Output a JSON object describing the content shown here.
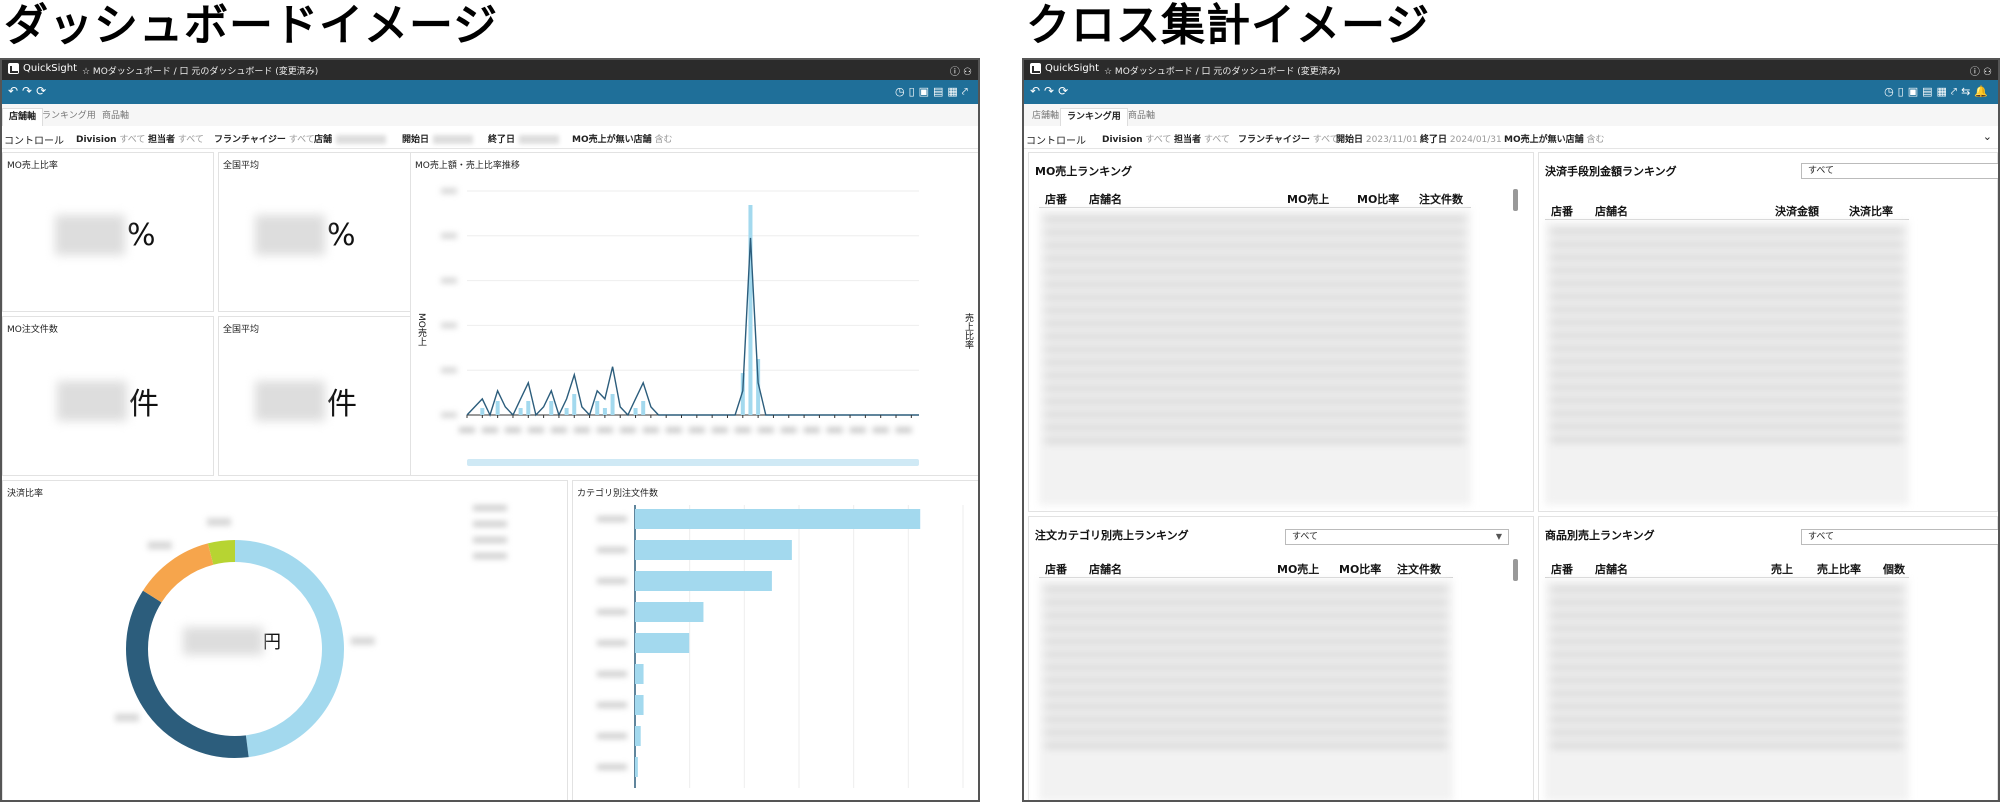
{
  "headings": {
    "dashboard": "ダッシュボードイメージ",
    "crosstab": "クロス集計イメージ"
  },
  "app": {
    "brand": "QuickSight",
    "breadcrumb_left": "☆ MOダッシュボード / 口 元のダッシュボード (変更済み)",
    "breadcrumb_right": "☆ MOダッシュボード / 口 元のダッシュボード (変更済み)"
  },
  "left": {
    "tabs": [
      "店舗軸",
      "ランキング用",
      "商品軸"
    ],
    "active_tab": 0,
    "controls": {
      "label": "コントロール",
      "division": "Division",
      "division_val": "すべて",
      "tanto": "担当者",
      "tanto_val": "すべて",
      "franchise": "フランチャイジー",
      "franchise_val": "すべて",
      "store": "店舗",
      "start": "開始日",
      "end": "終了日",
      "low": "MO売上が無い店舗",
      "low_val": "含む"
    },
    "kpis": [
      {
        "title": "MO売上比率",
        "unit": "%"
      },
      {
        "title": "全国平均",
        "unit": "%"
      },
      {
        "title": "MO注文件数",
        "unit": "件"
      },
      {
        "title": "全国平均",
        "unit": "件"
      }
    ],
    "trend_title": "MO売上額・売上比率推移",
    "trend_ylabel": "MO売上",
    "trend_y2label": "売上比率",
    "donut_title": "決済比率",
    "donut_unit": "円",
    "bars_title": "カテゴリ別注文件数"
  },
  "right": {
    "tabs": [
      "店舗軸",
      "ランキング用",
      "商品軸"
    ],
    "active_tab": 1,
    "controls": {
      "label": "コントロール",
      "division": "Division",
      "division_val": "すべて",
      "tanto": "担当者",
      "tanto_val": "すべて",
      "franchise": "フランチャイジー",
      "franchise_val": "すべて",
      "start": "開始日",
      "start_val": "2023/11/01",
      "end": "終了日",
      "end_val": "2024/01/31",
      "low": "MO売上が無い店舗",
      "low_val": "含む"
    },
    "t1": {
      "title": "MO売上ランキング",
      "cols": [
        "店番",
        "店舗名",
        "MO売上",
        "MO比率",
        "注文件数"
      ]
    },
    "t2": {
      "title": "決済手段別金額ランキング",
      "select": "すべて",
      "cols": [
        "店番",
        "店舗名",
        "決済金額",
        "決済比率"
      ]
    },
    "t3": {
      "title": "注文カテゴリ別売上ランキング",
      "select": "すべて",
      "cols": [
        "店番",
        "店舗名",
        "MO売上",
        "MO比率",
        "注文件数"
      ]
    },
    "t4": {
      "title": "商品別売上ランキング",
      "select": "すべて",
      "cols": [
        "店番",
        "店舗名",
        "売上",
        "売上比率",
        "個数"
      ]
    }
  },
  "chart_data": [
    {
      "type": "line",
      "title": "MO売上額・売上比率推移",
      "ylabel": "MO売上",
      "series": [
        {
          "values": [
            0,
            1,
            2,
            0,
            3,
            1,
            0,
            2,
            4,
            0,
            1,
            3,
            0,
            2,
            5,
            1,
            0,
            3,
            2,
            6,
            1,
            0,
            2,
            4,
            1,
            0,
            0,
            0,
            0,
            0,
            0,
            0,
            0,
            0,
            0,
            0,
            3,
            22,
            4,
            0,
            0,
            0,
            0,
            0,
            0,
            0,
            0,
            0,
            0,
            0,
            0,
            0,
            0,
            0,
            0,
            0,
            0,
            0,
            0,
            0
          ]
        },
        {
          "values": [
            0,
            0,
            1,
            0,
            2,
            0,
            0,
            1,
            2,
            0,
            0,
            2,
            0,
            1,
            3,
            0,
            0,
            2,
            1,
            3,
            0,
            0,
            1,
            2,
            0,
            0,
            0,
            0,
            0,
            0,
            0,
            0,
            0,
            0,
            0,
            0,
            6,
            30,
            8,
            0,
            0,
            0,
            0,
            0,
            0,
            0,
            0,
            0,
            0,
            0,
            0,
            0,
            0,
            0,
            0,
            0,
            0,
            0,
            0,
            0
          ]
        }
      ]
    },
    {
      "type": "pie",
      "title": "決済比率",
      "slices": [
        {
          "value": 48,
          "color": "#a3d9ee"
        },
        {
          "value": 36,
          "color": "#2c5d7c"
        },
        {
          "value": 12,
          "color": "#f6a54c"
        },
        {
          "value": 4,
          "color": "#b7d432"
        }
      ]
    },
    {
      "type": "bar",
      "title": "カテゴリ別注文件数",
      "values": [
        100,
        55,
        48,
        24,
        19,
        3,
        3,
        2,
        1
      ]
    }
  ]
}
